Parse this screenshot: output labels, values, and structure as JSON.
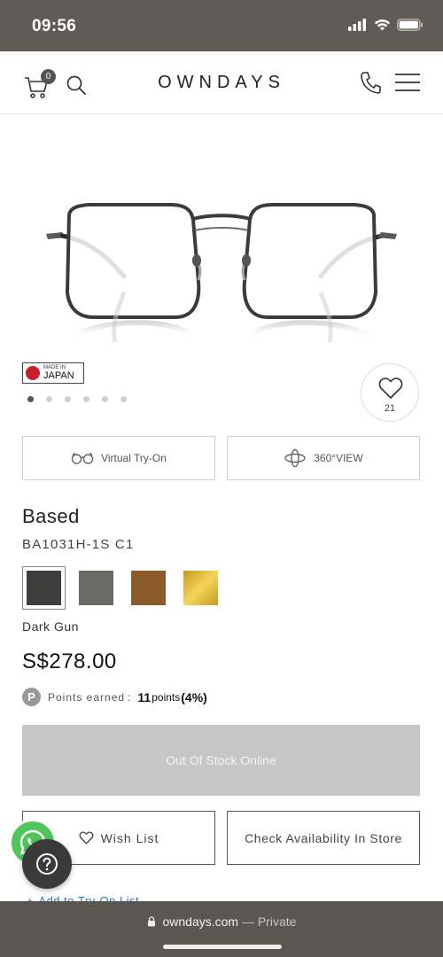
{
  "status_bar": {
    "time": "09:56",
    "icons": [
      "signal-icon",
      "wifi-icon",
      "battery-icon"
    ]
  },
  "header": {
    "brand": "OWNDAYS",
    "cart_count": "0",
    "icons": [
      "cart-icon",
      "search-icon",
      "phone-icon",
      "menu-icon"
    ]
  },
  "badge": {
    "made_in_small": "MADE IN",
    "made_in_big": "JAPAN"
  },
  "gallery": {
    "total_slides": 6,
    "active_index": 0
  },
  "favorite": {
    "count": "21"
  },
  "tryon": {
    "virtual_label": "Virtual Try-On",
    "view360_label": "360°VIEW"
  },
  "product": {
    "name": "Based",
    "code": "BA1031H-1S C1",
    "color_name": "Dark Gun",
    "price": "S$278.00"
  },
  "swatches": [
    {
      "color": "#3e3e3c",
      "selected": true
    },
    {
      "color": "#6a6a66",
      "selected": false
    },
    {
      "color": "#8a5a28",
      "selected": false
    },
    {
      "color": "#d6a626",
      "selected": false
    }
  ],
  "points": {
    "icon_letter": "P",
    "label": "Points earned",
    "separator": ":",
    "value": "11",
    "unit": "points",
    "percent": "(4%)"
  },
  "actions": {
    "out_of_stock": "Out Of Stock Online",
    "wish_list": "Wish List",
    "check_store": "Check Availability In Store",
    "add_tryon": "Add to Try-On List"
  },
  "browser": {
    "domain": "owndays.com",
    "mode": "— Private"
  },
  "colors": {
    "status_bg": "#5f5b55",
    "oos_bg": "#c6c6c6",
    "link": "#2a78c2",
    "whatsapp": "#4fc65a"
  }
}
